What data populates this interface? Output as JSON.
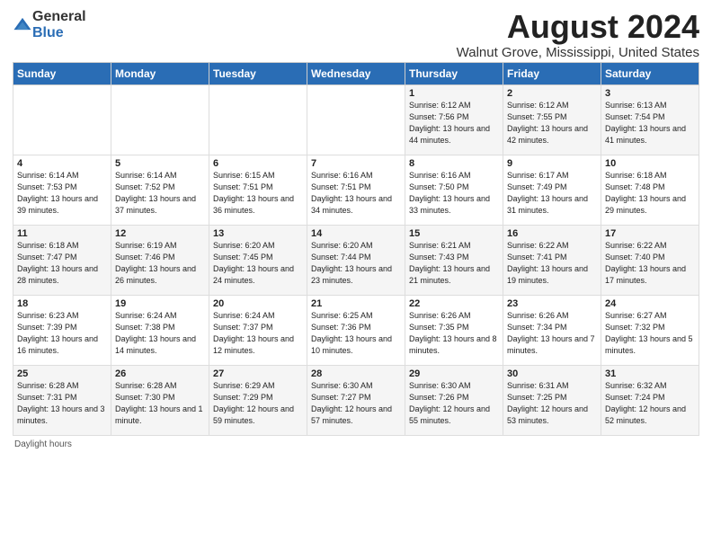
{
  "header": {
    "logo_general": "General",
    "logo_blue": "Blue",
    "month_title": "August 2024",
    "location": "Walnut Grove, Mississippi, United States"
  },
  "days_of_week": [
    "Sunday",
    "Monday",
    "Tuesday",
    "Wednesday",
    "Thursday",
    "Friday",
    "Saturday"
  ],
  "weeks": [
    [
      {
        "day": "",
        "sunrise": "",
        "sunset": "",
        "daylight": ""
      },
      {
        "day": "",
        "sunrise": "",
        "sunset": "",
        "daylight": ""
      },
      {
        "day": "",
        "sunrise": "",
        "sunset": "",
        "daylight": ""
      },
      {
        "day": "",
        "sunrise": "",
        "sunset": "",
        "daylight": ""
      },
      {
        "day": "1",
        "sunrise": "Sunrise: 6:12 AM",
        "sunset": "Sunset: 7:56 PM",
        "daylight": "Daylight: 13 hours and 44 minutes."
      },
      {
        "day": "2",
        "sunrise": "Sunrise: 6:12 AM",
        "sunset": "Sunset: 7:55 PM",
        "daylight": "Daylight: 13 hours and 42 minutes."
      },
      {
        "day": "3",
        "sunrise": "Sunrise: 6:13 AM",
        "sunset": "Sunset: 7:54 PM",
        "daylight": "Daylight: 13 hours and 41 minutes."
      }
    ],
    [
      {
        "day": "4",
        "sunrise": "Sunrise: 6:14 AM",
        "sunset": "Sunset: 7:53 PM",
        "daylight": "Daylight: 13 hours and 39 minutes."
      },
      {
        "day": "5",
        "sunrise": "Sunrise: 6:14 AM",
        "sunset": "Sunset: 7:52 PM",
        "daylight": "Daylight: 13 hours and 37 minutes."
      },
      {
        "day": "6",
        "sunrise": "Sunrise: 6:15 AM",
        "sunset": "Sunset: 7:51 PM",
        "daylight": "Daylight: 13 hours and 36 minutes."
      },
      {
        "day": "7",
        "sunrise": "Sunrise: 6:16 AM",
        "sunset": "Sunset: 7:51 PM",
        "daylight": "Daylight: 13 hours and 34 minutes."
      },
      {
        "day": "8",
        "sunrise": "Sunrise: 6:16 AM",
        "sunset": "Sunset: 7:50 PM",
        "daylight": "Daylight: 13 hours and 33 minutes."
      },
      {
        "day": "9",
        "sunrise": "Sunrise: 6:17 AM",
        "sunset": "Sunset: 7:49 PM",
        "daylight": "Daylight: 13 hours and 31 minutes."
      },
      {
        "day": "10",
        "sunrise": "Sunrise: 6:18 AM",
        "sunset": "Sunset: 7:48 PM",
        "daylight": "Daylight: 13 hours and 29 minutes."
      }
    ],
    [
      {
        "day": "11",
        "sunrise": "Sunrise: 6:18 AM",
        "sunset": "Sunset: 7:47 PM",
        "daylight": "Daylight: 13 hours and 28 minutes."
      },
      {
        "day": "12",
        "sunrise": "Sunrise: 6:19 AM",
        "sunset": "Sunset: 7:46 PM",
        "daylight": "Daylight: 13 hours and 26 minutes."
      },
      {
        "day": "13",
        "sunrise": "Sunrise: 6:20 AM",
        "sunset": "Sunset: 7:45 PM",
        "daylight": "Daylight: 13 hours and 24 minutes."
      },
      {
        "day": "14",
        "sunrise": "Sunrise: 6:20 AM",
        "sunset": "Sunset: 7:44 PM",
        "daylight": "Daylight: 13 hours and 23 minutes."
      },
      {
        "day": "15",
        "sunrise": "Sunrise: 6:21 AM",
        "sunset": "Sunset: 7:43 PM",
        "daylight": "Daylight: 13 hours and 21 minutes."
      },
      {
        "day": "16",
        "sunrise": "Sunrise: 6:22 AM",
        "sunset": "Sunset: 7:41 PM",
        "daylight": "Daylight: 13 hours and 19 minutes."
      },
      {
        "day": "17",
        "sunrise": "Sunrise: 6:22 AM",
        "sunset": "Sunset: 7:40 PM",
        "daylight": "Daylight: 13 hours and 17 minutes."
      }
    ],
    [
      {
        "day": "18",
        "sunrise": "Sunrise: 6:23 AM",
        "sunset": "Sunset: 7:39 PM",
        "daylight": "Daylight: 13 hours and 16 minutes."
      },
      {
        "day": "19",
        "sunrise": "Sunrise: 6:24 AM",
        "sunset": "Sunset: 7:38 PM",
        "daylight": "Daylight: 13 hours and 14 minutes."
      },
      {
        "day": "20",
        "sunrise": "Sunrise: 6:24 AM",
        "sunset": "Sunset: 7:37 PM",
        "daylight": "Daylight: 13 hours and 12 minutes."
      },
      {
        "day": "21",
        "sunrise": "Sunrise: 6:25 AM",
        "sunset": "Sunset: 7:36 PM",
        "daylight": "Daylight: 13 hours and 10 minutes."
      },
      {
        "day": "22",
        "sunrise": "Sunrise: 6:26 AM",
        "sunset": "Sunset: 7:35 PM",
        "daylight": "Daylight: 13 hours and 8 minutes."
      },
      {
        "day": "23",
        "sunrise": "Sunrise: 6:26 AM",
        "sunset": "Sunset: 7:34 PM",
        "daylight": "Daylight: 13 hours and 7 minutes."
      },
      {
        "day": "24",
        "sunrise": "Sunrise: 6:27 AM",
        "sunset": "Sunset: 7:32 PM",
        "daylight": "Daylight: 13 hours and 5 minutes."
      }
    ],
    [
      {
        "day": "25",
        "sunrise": "Sunrise: 6:28 AM",
        "sunset": "Sunset: 7:31 PM",
        "daylight": "Daylight: 13 hours and 3 minutes."
      },
      {
        "day": "26",
        "sunrise": "Sunrise: 6:28 AM",
        "sunset": "Sunset: 7:30 PM",
        "daylight": "Daylight: 13 hours and 1 minute."
      },
      {
        "day": "27",
        "sunrise": "Sunrise: 6:29 AM",
        "sunset": "Sunset: 7:29 PM",
        "daylight": "Daylight: 12 hours and 59 minutes."
      },
      {
        "day": "28",
        "sunrise": "Sunrise: 6:30 AM",
        "sunset": "Sunset: 7:27 PM",
        "daylight": "Daylight: 12 hours and 57 minutes."
      },
      {
        "day": "29",
        "sunrise": "Sunrise: 6:30 AM",
        "sunset": "Sunset: 7:26 PM",
        "daylight": "Daylight: 12 hours and 55 minutes."
      },
      {
        "day": "30",
        "sunrise": "Sunrise: 6:31 AM",
        "sunset": "Sunset: 7:25 PM",
        "daylight": "Daylight: 12 hours and 53 minutes."
      },
      {
        "day": "31",
        "sunrise": "Sunrise: 6:32 AM",
        "sunset": "Sunset: 7:24 PM",
        "daylight": "Daylight: 12 hours and 52 minutes."
      }
    ]
  ],
  "footer": {
    "daylight_label": "Daylight hours"
  }
}
